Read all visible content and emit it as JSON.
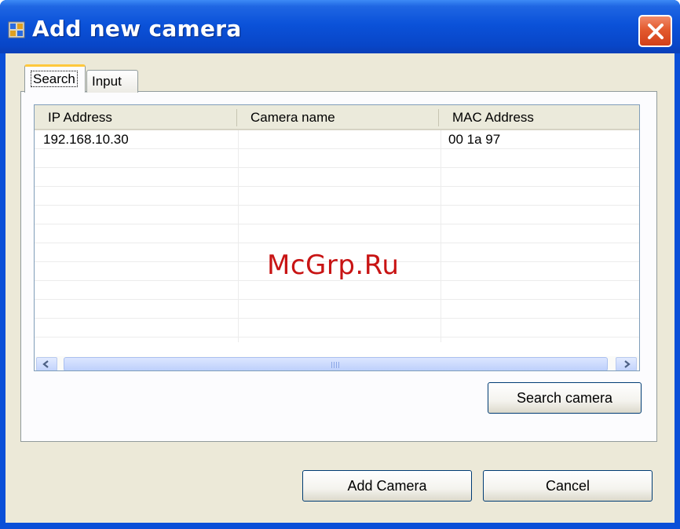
{
  "window": {
    "title": "Add new camera"
  },
  "tabs": [
    {
      "label": "Search",
      "selected": true
    },
    {
      "label": "Input",
      "selected": false
    }
  ],
  "list": {
    "columns": [
      "IP Address",
      "Camera name",
      "MAC Address"
    ],
    "rows": [
      {
        "ip": "192.168.10.30",
        "name": "",
        "mac": "00 1a 97      "
      }
    ]
  },
  "buttons": {
    "search_camera": "Search camera",
    "add_camera": "Add Camera",
    "cancel": "Cancel"
  },
  "watermark": "McGrp.Ru",
  "colors": {
    "titlebar": "#0b52d9",
    "close": "#e35a2e",
    "tab_highlight": "#ffc83c",
    "watermark": "#c81414"
  }
}
